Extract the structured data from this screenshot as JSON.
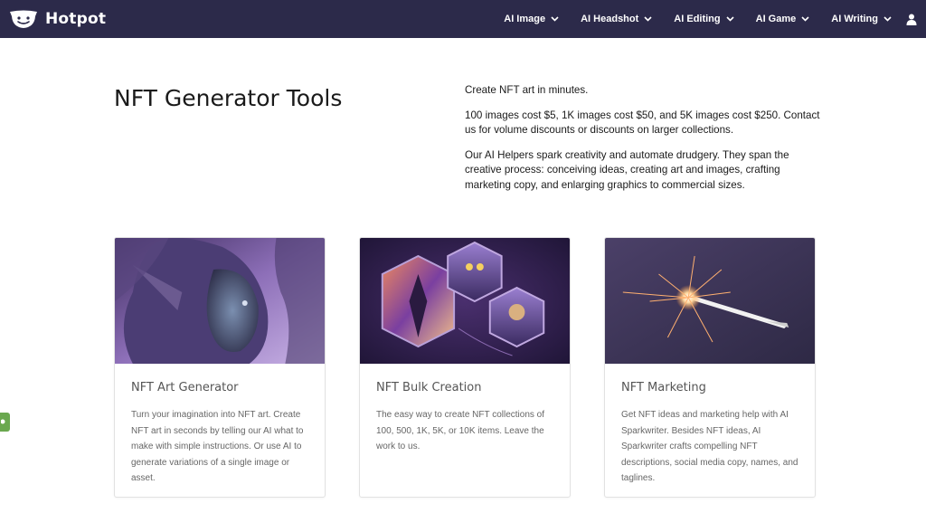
{
  "brand": {
    "name": "Hotpot",
    "color": "#2c2a4a"
  },
  "nav": {
    "items": [
      {
        "label": "AI Image"
      },
      {
        "label": "AI Headshot"
      },
      {
        "label": "AI Editing"
      },
      {
        "label": "AI Game"
      },
      {
        "label": "AI Writing"
      }
    ],
    "user_icon": "user-icon"
  },
  "page": {
    "title": "NFT Generator Tools",
    "intro": [
      "Create NFT art in minutes.",
      "100 images cost $5, 1K images cost $50, and 5K images cost $250. Contact us for volume discounts or discounts on larger collections.",
      "Our AI Helpers spark creativity and automate drudgery. They span the creative process: conceiving ideas, creating art and images, crafting marketing copy, and enlarging graphics to commercial sizes."
    ]
  },
  "cards": [
    {
      "title": "NFT Art Generator",
      "description": "Turn your imagination into NFT art. Create NFT art in seconds by telling our AI what to make with simple instructions. Or use AI to generate variations of a single image or asset."
    },
    {
      "title": "NFT Bulk Creation",
      "description": "The easy way to create NFT collections of 100, 500, 1K, 5K, or 10K items. Leave the work to us."
    },
    {
      "title": "NFT Marketing",
      "description": "Get NFT ideas and marketing help with AI Sparkwriter. Besides NFT ideas, AI Sparkwriter crafts compelling NFT descriptions, social media copy, names, and taglines."
    }
  ],
  "side_tab": {
    "color": "#6aa84f"
  }
}
